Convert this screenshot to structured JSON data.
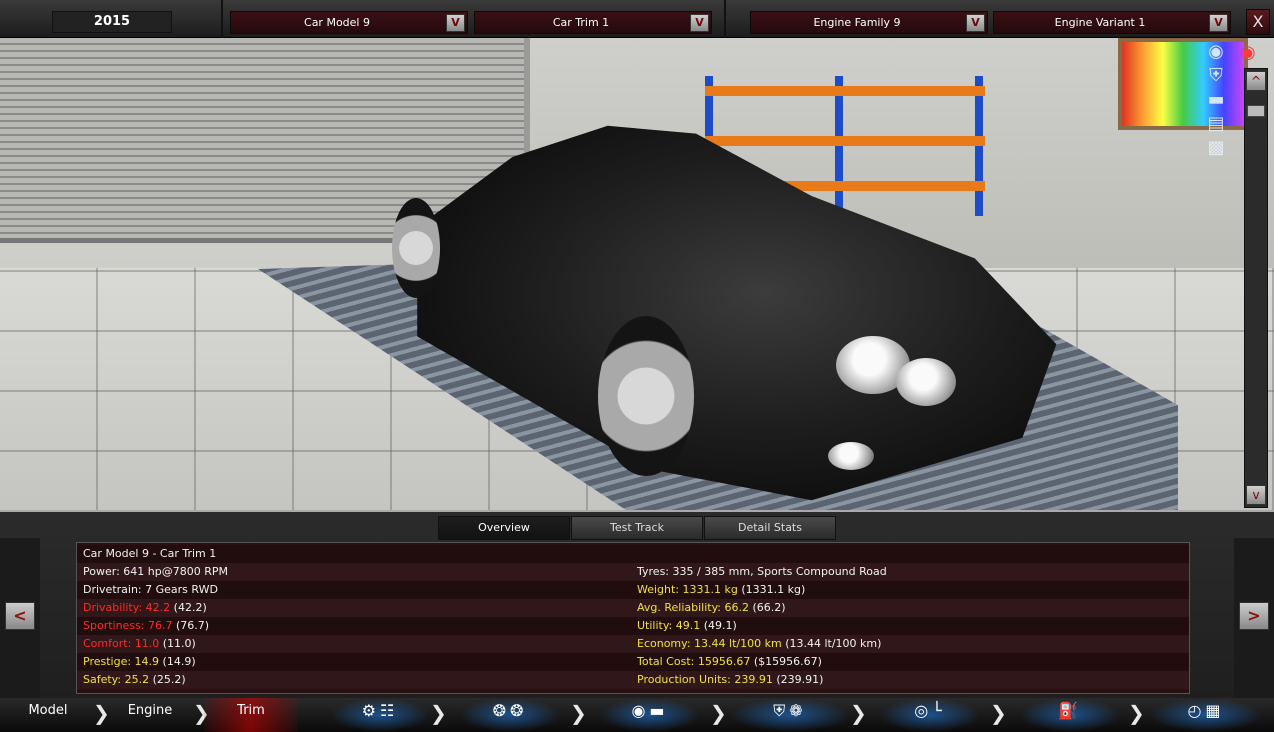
{
  "topbar": {
    "year": "2015",
    "car_model": "Car Model 9",
    "car_trim": "Car Trim 1",
    "engine_family": "Engine Family 9",
    "engine_variant": "Engine Variant 1",
    "dropdown_glyph": "V",
    "close_glyph": "X"
  },
  "scene": {
    "scroll_up": "^",
    "scroll_down": "v",
    "icons": [
      "camera-icon",
      "car-front-icon",
      "car-side-icon",
      "car-seat-icon",
      "car-top-icon"
    ]
  },
  "tabs": [
    {
      "label": "Overview",
      "active": true
    },
    {
      "label": "Test Track",
      "active": false
    },
    {
      "label": "Detail Stats",
      "active": false
    }
  ],
  "nav": {
    "prev": "<",
    "next": ">"
  },
  "stats": {
    "header": "Car Model 9 - Car Trim 1",
    "left": [
      {
        "label": "Power: 641 hp@7800 RPM",
        "extra": "",
        "color": "white"
      },
      {
        "label": "Drivetrain: 7 Gears RWD",
        "extra": "",
        "color": "white"
      },
      {
        "label": "Drivability: 42.2",
        "extra": " (42.2)",
        "color": "red"
      },
      {
        "label": "Sportiness: 76.7",
        "extra": " (76.7)",
        "color": "red"
      },
      {
        "label": "Comfort: 11.0",
        "extra": " (11.0)",
        "color": "red"
      },
      {
        "label": "Prestige: 14.9",
        "extra": " (14.9)",
        "color": "yellow"
      },
      {
        "label": "Safety: 25.2",
        "extra": " (25.2)",
        "color": "yellow"
      }
    ],
    "right": [
      {
        "label": "Tyres: 335 / 385 mm, Sports Compound Road",
        "extra": "",
        "color": "white"
      },
      {
        "label": "Weight: 1331.1 kg",
        "extra": " (1331.1 kg)",
        "color": "yellow"
      },
      {
        "label": "Avg. Reliability: 66.2",
        "extra": " (66.2)",
        "color": "yellow"
      },
      {
        "label": "Utility: 49.1",
        "extra": " (49.1)",
        "color": "yellow"
      },
      {
        "label": "Economy: 13.44 lt/100 km",
        "extra": " (13.44 lt/100 km)",
        "color": "yellow"
      },
      {
        "label": "Total Cost: 15956.67",
        "extra": " ($15956.67)",
        "color": "yellow"
      },
      {
        "label": "Production Units: 239.91",
        "extra": " (239.91)",
        "color": "yellow"
      }
    ]
  },
  "bottom_nav": {
    "model": "Model",
    "engine": "Engine",
    "trim": "Trim",
    "sections": [
      "gear-icon",
      "wheels-icon",
      "brake-icon",
      "aero-icon",
      "interior-icon",
      "fuel-icon",
      "test-flag-icon"
    ]
  },
  "colors": {
    "red": "#ff2a2a",
    "yellow": "#f0e23a",
    "accent": "#8a0f0f"
  }
}
